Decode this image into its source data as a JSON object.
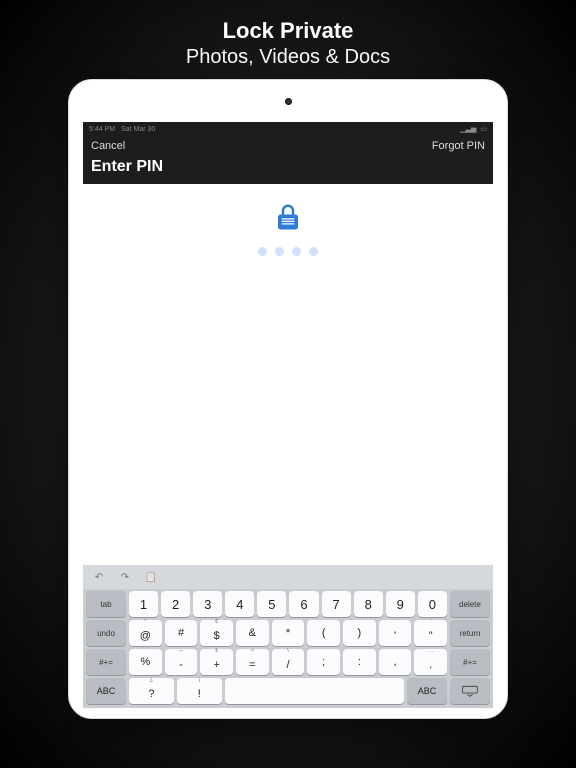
{
  "promo": {
    "line1": "Lock Private",
    "line2": "Photos, Videos & Docs"
  },
  "statusbar": {
    "time": "5:44 PM",
    "date": "Sat Mar 30"
  },
  "nav": {
    "cancel": "Cancel",
    "forgot": "Forgot PIN",
    "title": "Enter PIN"
  },
  "pin": {
    "length": 4
  },
  "keyboard": {
    "row1_left": "tab",
    "row1_right": "delete",
    "row1": [
      "1",
      "2",
      "3",
      "4",
      "5",
      "6",
      "7",
      "8",
      "9",
      "0"
    ],
    "row2_left": "undo",
    "row2_right": "return",
    "row2": [
      {
        "main": "@",
        "sub": "°"
      },
      {
        "main": "#",
        "sub": ""
      },
      {
        "main": "$",
        "sub": "¢"
      },
      {
        "main": "&",
        "sub": ""
      },
      {
        "main": "*",
        "sub": ""
      },
      {
        "main": "(",
        "sub": ""
      },
      {
        "main": ")",
        "sub": ""
      },
      {
        "main": "'",
        "sub": "’"
      },
      {
        "main": "\"",
        "sub": "”"
      }
    ],
    "row3_side": "#+=",
    "row3": [
      {
        "main": "%",
        "sub": ""
      },
      {
        "main": "-",
        "sub": "–"
      },
      {
        "main": "+",
        "sub": "±"
      },
      {
        "main": "=",
        "sub": "≈"
      },
      {
        "main": "/",
        "sub": "\\"
      },
      {
        "main": ";",
        "sub": ""
      },
      {
        "main": ":",
        "sub": ""
      },
      {
        "main": ",",
        "sub": ""
      },
      {
        "main": ".",
        "sub": "…"
      }
    ],
    "row4_abc": "ABC",
    "row4": [
      {
        "main": "?",
        "sub": "¿"
      },
      {
        "main": "!",
        "sub": "¡"
      },
      {
        "main": "",
        "sub": "",
        "space": true
      }
    ]
  }
}
